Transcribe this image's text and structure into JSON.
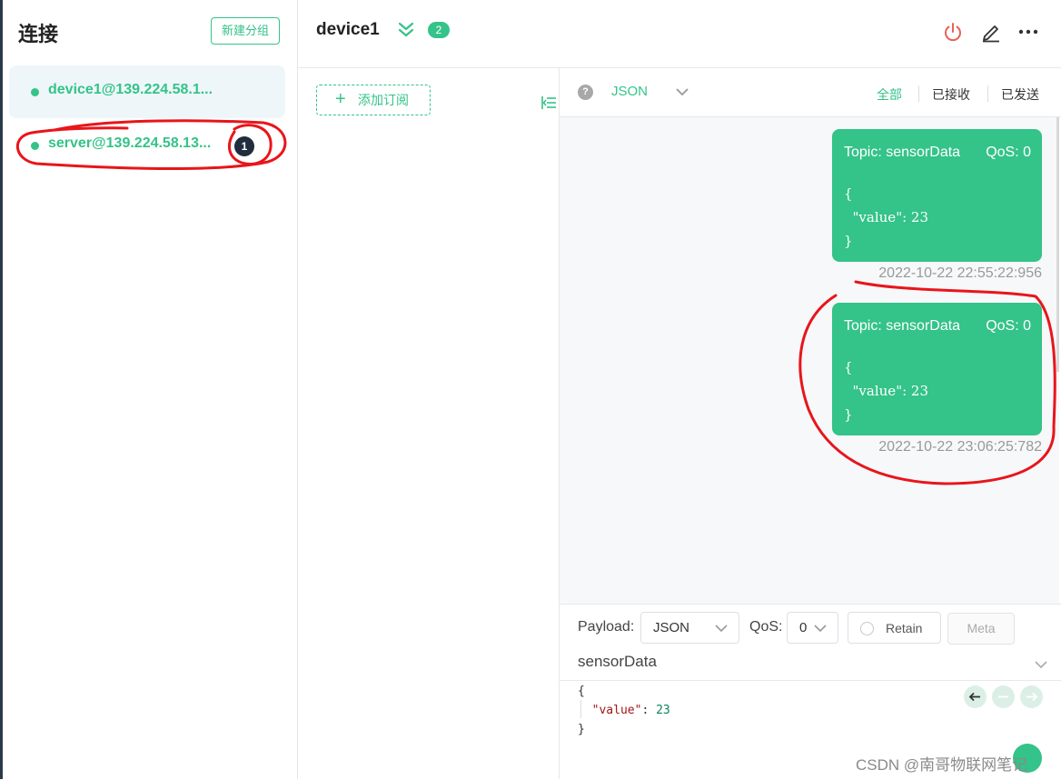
{
  "sidebar": {
    "title": "连接",
    "new_group_label": "新建分组",
    "connections": [
      {
        "name": "device1@139.224.58.1..."
      },
      {
        "name": "server@139.224.58.13...",
        "unread": "1"
      }
    ]
  },
  "header": {
    "title": "device1",
    "count_badge": "2",
    "icons": [
      "expand-icon",
      "power-icon",
      "edit-icon",
      "more-icon"
    ]
  },
  "subscriptions": {
    "add_label": "添加订阅"
  },
  "toolbar": {
    "help": "?",
    "format": "JSON",
    "filters": [
      "全部",
      "已接收",
      "已发送"
    ]
  },
  "messages": [
    {
      "topic": "Topic: sensorData",
      "qos": "QoS: 0",
      "payload": "{\n  \"value\": 23\n}",
      "time": "2022-10-22 22:55:22:956"
    },
    {
      "topic": "Topic: sensorData",
      "qos": "QoS: 0",
      "payload": "{\n  \"value\": 23\n}",
      "time": "2022-10-22 23:06:25:782"
    }
  ],
  "composer": {
    "payload_label": "Payload:",
    "payload_format": "JSON",
    "qos_label": "QoS:",
    "qos_value": "0",
    "retain_label": "Retain",
    "meta_label": "Meta",
    "topic": "sensorData",
    "editor": {
      "open": "{",
      "key": "\"value\"",
      "colon": ": ",
      "value": "23",
      "close": "}"
    }
  },
  "watermark": "CSDN @南哥物联网笔记",
  "colors": {
    "accent": "#34c388",
    "annotation": "#e8151b"
  }
}
